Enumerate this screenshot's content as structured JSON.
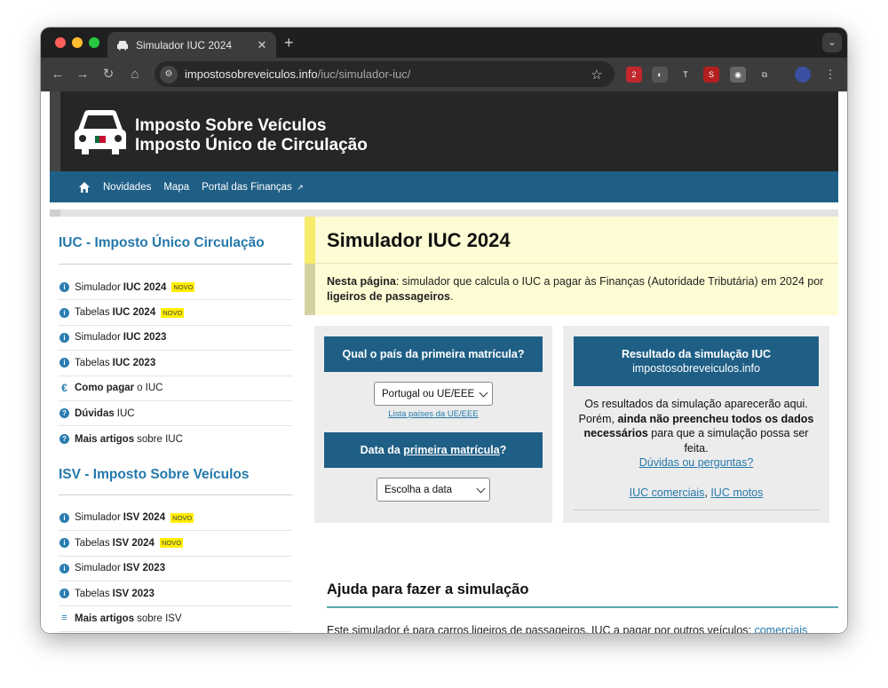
{
  "browser": {
    "tab_title": "Simulador IUC 2024",
    "tab_close": "✕",
    "new_tab": "+",
    "url_host": "impostosobreveiculos.info",
    "url_path": "/iuc/simulador-iuc/",
    "ext_badge": "2"
  },
  "site": {
    "title_line1": "Imposto Sobre Veículos",
    "title_line2": "Imposto Único de Circulação",
    "nav": [
      "Novidades",
      "Mapa",
      "Portal das Finanças"
    ]
  },
  "sidebar": {
    "iuc_heading": "IUC - Imposto Único Circulação",
    "iuc_items": [
      {
        "pre": "Simulador",
        "bold": "IUC 2024",
        "post": "",
        "novo": "NOVO",
        "icon": "info-icon"
      },
      {
        "pre": "Tabelas",
        "bold": "IUC 2024",
        "post": "",
        "novo": "NOVO",
        "icon": "info-icon"
      },
      {
        "pre": "Simulador",
        "bold": "IUC 2023",
        "post": "",
        "novo": "",
        "icon": "info-icon"
      },
      {
        "pre": "Tabelas",
        "bold": "IUC 2023",
        "post": "",
        "novo": "",
        "icon": "info-icon"
      },
      {
        "pre": "",
        "bold": "Como pagar",
        "post": "o IUC",
        "novo": "",
        "icon": "euro-icon"
      },
      {
        "pre": "",
        "bold": "Dúvidas",
        "post": "IUC",
        "novo": "",
        "icon": "question-icon"
      },
      {
        "pre": "",
        "bold": "Mais artigos",
        "post": "sobre IUC",
        "novo": "",
        "icon": "question-icon"
      }
    ],
    "isv_heading": "ISV - Imposto Sobre Veículos",
    "isv_items": [
      {
        "pre": "Simulador",
        "bold": "ISV 2024",
        "post": "",
        "novo": "NOVO",
        "icon": "info-icon"
      },
      {
        "pre": "Tabelas",
        "bold": "ISV 2024",
        "post": "",
        "novo": "NOVO",
        "icon": "info-icon"
      },
      {
        "pre": "Simulador",
        "bold": "ISV 2023",
        "post": "",
        "novo": "",
        "icon": "info-icon"
      },
      {
        "pre": "Tabelas",
        "bold": "ISV 2023",
        "post": "",
        "novo": "",
        "icon": "info-icon"
      },
      {
        "pre": "",
        "bold": "Mais artigos",
        "post": "sobre ISV",
        "novo": "",
        "icon": "list-icon"
      }
    ]
  },
  "main": {
    "title": "Simulador IUC 2024",
    "intro_bold": "Nesta página",
    "intro_text": ": simulador que calcula o IUC a pagar às Finanças (Autoridade Tributária) em 2024 por ",
    "intro_bold2": "ligeiros de passageiros",
    "intro_end": ".",
    "q1": "Qual o país da primeira matrícula?",
    "select1_value": "Portugal ou UE/EEE",
    "select1_link": "Lista países da UE/EEE",
    "q2_pre": "Data da ",
    "q2_link": "primeira matrícula",
    "q2_post": "?",
    "select2_value": "Escolha a data",
    "result_head": "Resultado da simulação IUC",
    "result_sub": "impostosobreveiculos.info",
    "result_text1": "Os resultados da simulação aparecerão aqui. Porém, ",
    "result_bold": "ainda não preencheu todos os dados necessários",
    "result_text2": " para que a simulação possa ser feita.",
    "result_link": "Dúvidas ou perguntas?",
    "link_comerciais": "IUC comerciais",
    "link_sep": ", ",
    "link_motos": "IUC motos",
    "help_title": "Ajuda para fazer a simulação",
    "help_text": "Este simulador é para carros ligeiros de passageiros. IUC a pagar por outros veículos: ",
    "help_link": "comerciais"
  }
}
